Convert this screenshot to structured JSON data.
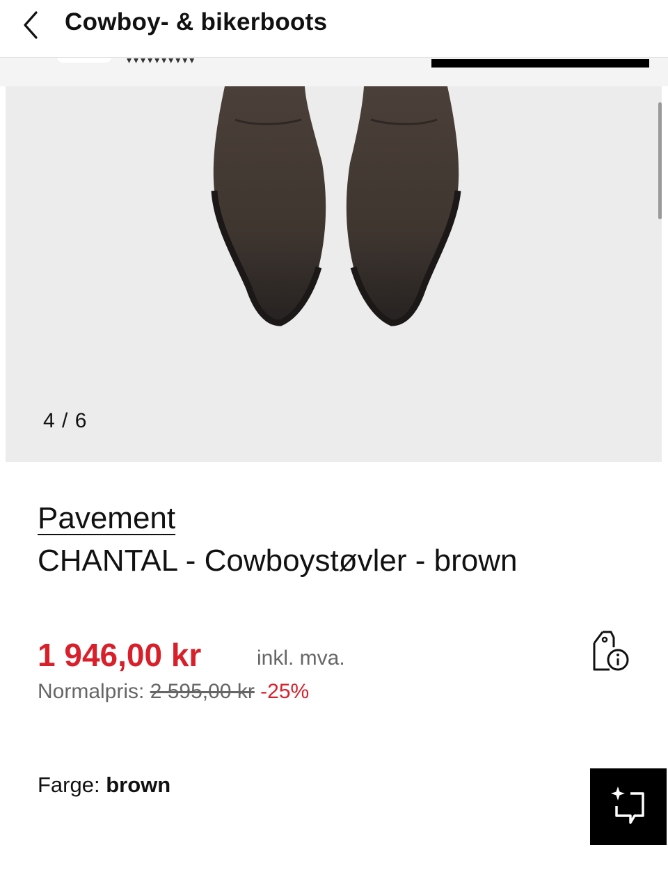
{
  "header": {
    "title": "Cowboy- & bikerboots"
  },
  "gallery": {
    "counter": "4 / 6"
  },
  "product": {
    "brand": "Pavement",
    "name": "CHANTAL - Cowboystøvler - brown",
    "price": "1 946,00 kr",
    "vat_note": "inkl. mva.",
    "normal_price_label": "Normalpris:",
    "normal_price": "2 595,00 kr",
    "discount": "-25%"
  },
  "color": {
    "label": "Farge:",
    "value": "brown"
  },
  "icons": {
    "back": "chevron-left-icon",
    "price_info": "price-tag-info-icon",
    "ai": "sparkle-chat-icon"
  },
  "colors": {
    "accent_red": "#d8202b",
    "boot_brown": "#4a3f37"
  }
}
